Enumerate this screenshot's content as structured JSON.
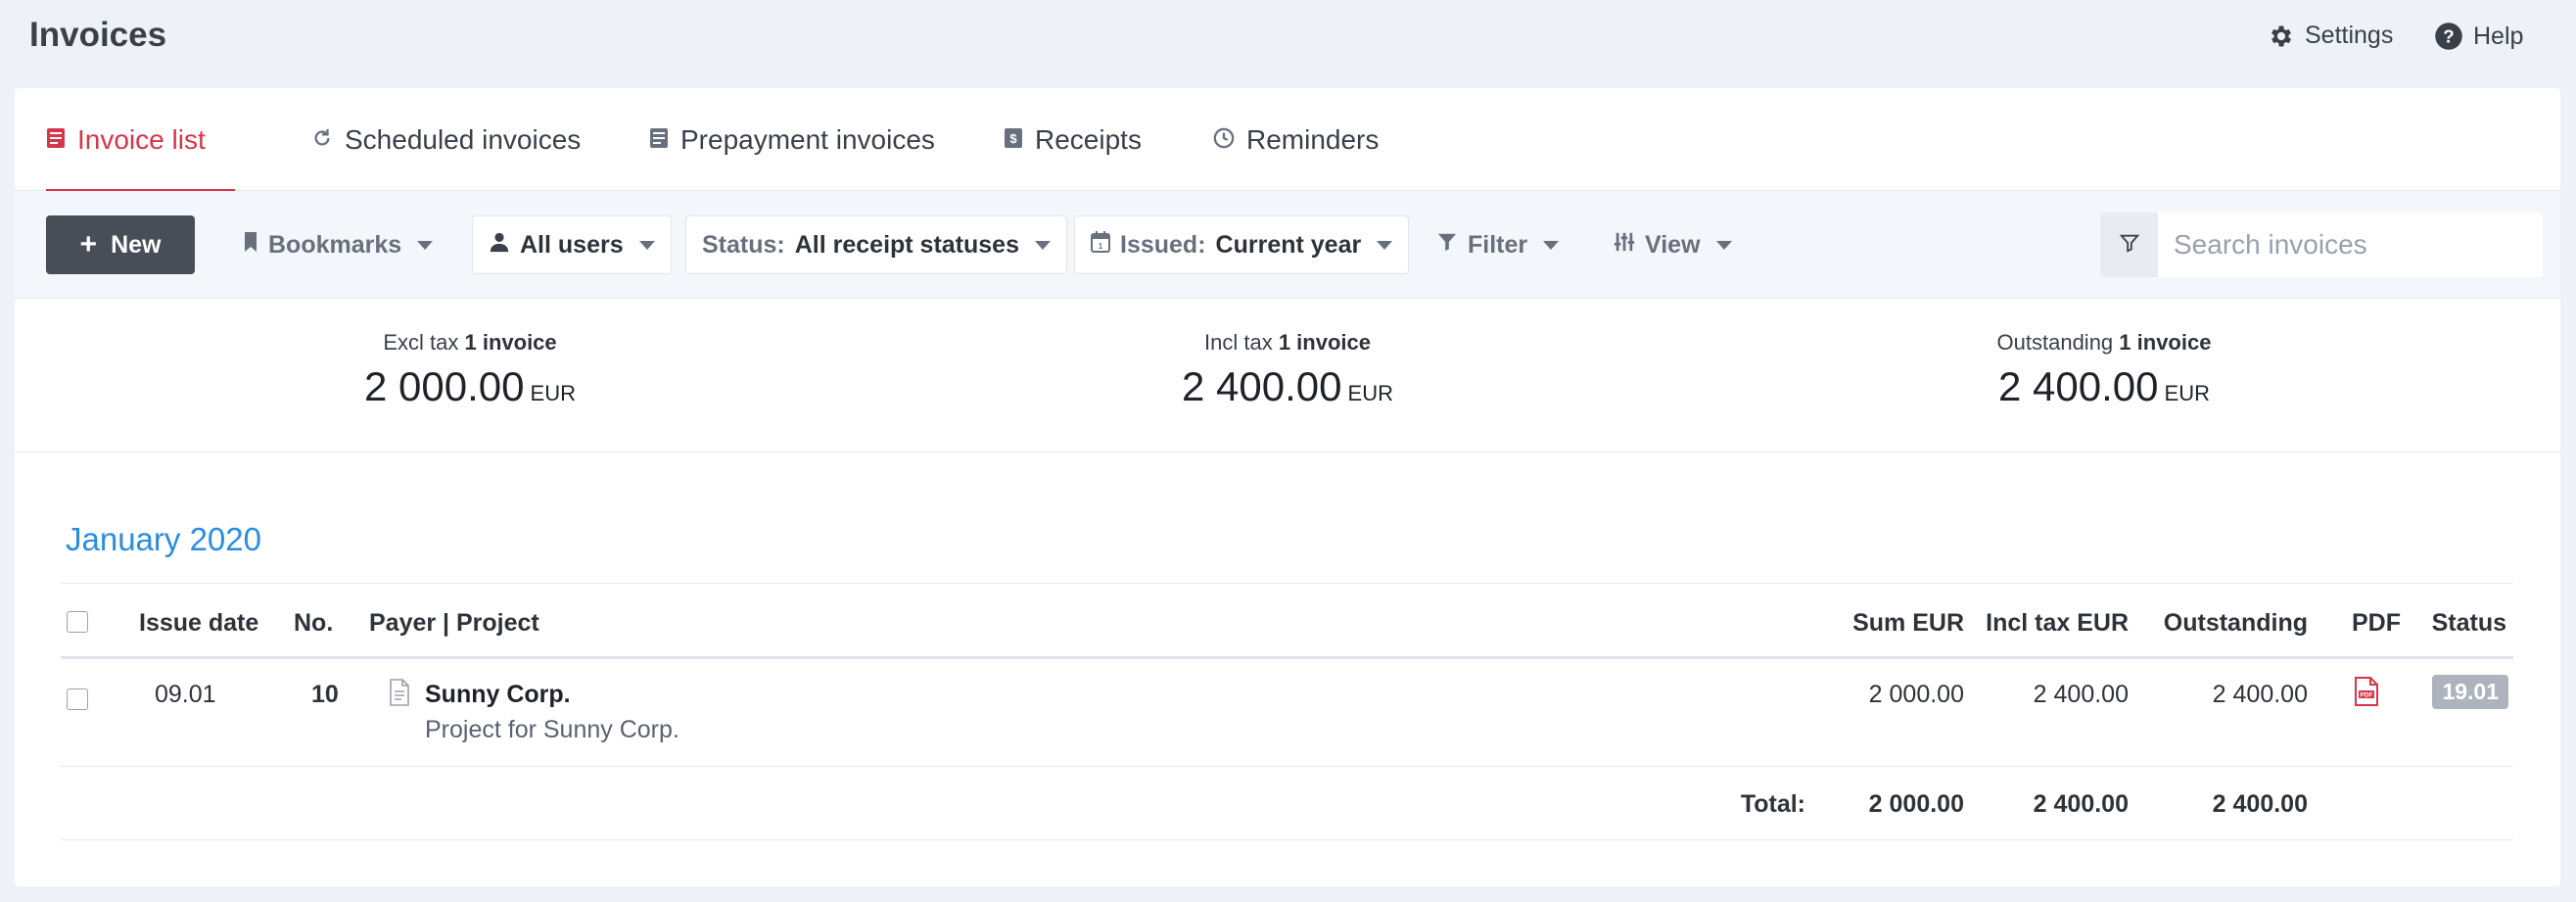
{
  "app": {
    "title": "Invoices"
  },
  "top_links": {
    "settings": "Settings",
    "help": "Help"
  },
  "tabs": [
    {
      "label": "Invoice list",
      "icon": "invoice-icon",
      "active": true
    },
    {
      "label": "Scheduled invoices",
      "icon": "refresh-icon",
      "active": false
    },
    {
      "label": "Prepayment invoices",
      "icon": "invoice-icon",
      "active": false
    },
    {
      "label": "Receipts",
      "icon": "receipt-icon",
      "active": false
    },
    {
      "label": "Reminders",
      "icon": "clock-icon",
      "active": false
    }
  ],
  "toolbar": {
    "new_label": "New",
    "bookmarks_label": "Bookmarks",
    "users_label": "All users",
    "status_prefix": "Status:",
    "status_value": "All receipt statuses",
    "issued_prefix": "Issued:",
    "issued_value": "Current year",
    "filter_label": "Filter",
    "view_label": "View",
    "search_placeholder": "Search invoices"
  },
  "summary": [
    {
      "label": "Excl tax",
      "count": "1 invoice",
      "value": "2 000.00",
      "currency": "EUR"
    },
    {
      "label": "Incl tax",
      "count": "1 invoice",
      "value": "2 400.00",
      "currency": "EUR"
    },
    {
      "label": "Outstanding",
      "count": "1 invoice",
      "value": "2 400.00",
      "currency": "EUR"
    }
  ],
  "group": {
    "month": "January 2020"
  },
  "table": {
    "headers": {
      "issue_date": "Issue date",
      "no": "No.",
      "payer_project": "Payer | Project",
      "sum": "Sum EUR",
      "incl_tax": "Incl tax EUR",
      "outstanding": "Outstanding",
      "pdf": "PDF",
      "status": "Status"
    },
    "rows": [
      {
        "issue_date": "09.01",
        "no": "10",
        "payer": "Sunny Corp.",
        "project": "Project for Sunny Corp.",
        "sum": "2 000.00",
        "incl_tax": "2 400.00",
        "outstanding": "2 400.00",
        "status": "19.01"
      }
    ],
    "totals": {
      "label": "Total:",
      "sum": "2 000.00",
      "incl_tax": "2 400.00",
      "outstanding": "2 400.00"
    }
  },
  "colors": {
    "accent": "#d8344a",
    "link": "#2b8de0",
    "primary_button": "#484e57",
    "status_badge": "#aeb4be"
  }
}
